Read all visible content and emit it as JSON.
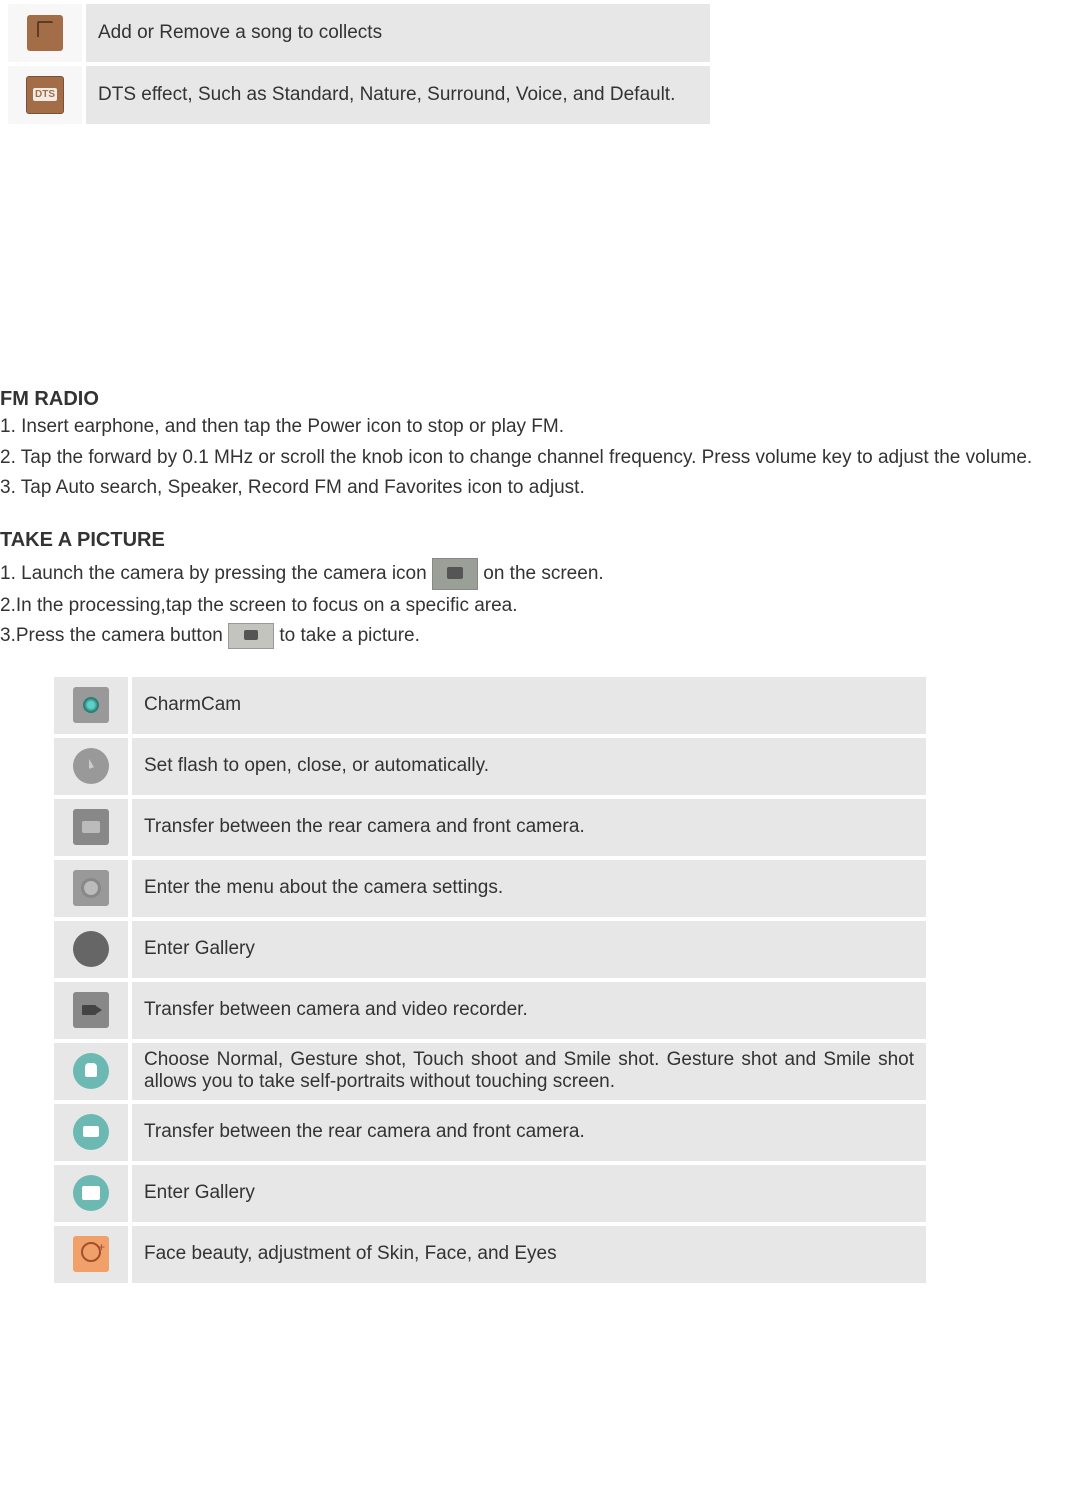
{
  "top_table": [
    {
      "icon": "thumb-icon",
      "text": "Add or Remove a song to collects"
    },
    {
      "icon": "dts-icon",
      "text": "DTS effect, Such as Standard, Nature, Surround, Voice, and Default."
    }
  ],
  "fm_radio": {
    "title": "FM RADIO",
    "items": [
      "1. Insert earphone, and then tap the Power icon to stop or play FM.",
      "2. Tap the forward by 0.1 MHz or scroll the knob icon to change channel frequency. Press volume key to adjust the volume.",
      "3. Tap Auto search, Speaker, Record FM and Favorites icon to adjust."
    ]
  },
  "take_picture": {
    "title": "TAKE A PICTURE",
    "step1_pre": "1. Launch the camera by pressing the camera icon ",
    "step1_post": "on the screen.",
    "step2": "2.In the processing,tap the screen to focus on a specific area.",
    "step3_pre": "3.Press the camera button",
    "step3_post": " to take a picture."
  },
  "main_table": [
    {
      "icon": "charmcam-icon",
      "text": "CharmCam"
    },
    {
      "icon": "flash-icon",
      "text": "Set flash to open, close, or automatically."
    },
    {
      "icon": "camera-switch-icon",
      "text": "Transfer between the rear camera and front camera."
    },
    {
      "icon": "gear-icon",
      "text": "Enter the menu about the camera settings."
    },
    {
      "icon": "gallery-icon",
      "text": "Enter Gallery"
    },
    {
      "icon": "video-icon",
      "text": "Transfer between camera and video recorder."
    },
    {
      "icon": "gesture-icon",
      "text": "Choose Normal, Gesture shot, Touch shoot and Smile shot. Gesture shot and Smile shot allows you to take self-portraits without touching screen."
    },
    {
      "icon": "camera-switch-teal-icon",
      "text": "Transfer between the rear camera and front camera."
    },
    {
      "icon": "gallery-teal-icon",
      "text": "Enter Gallery"
    },
    {
      "icon": "face-beauty-icon",
      "text": "Face beauty, adjustment of Skin, Face, and Eyes"
    }
  ]
}
